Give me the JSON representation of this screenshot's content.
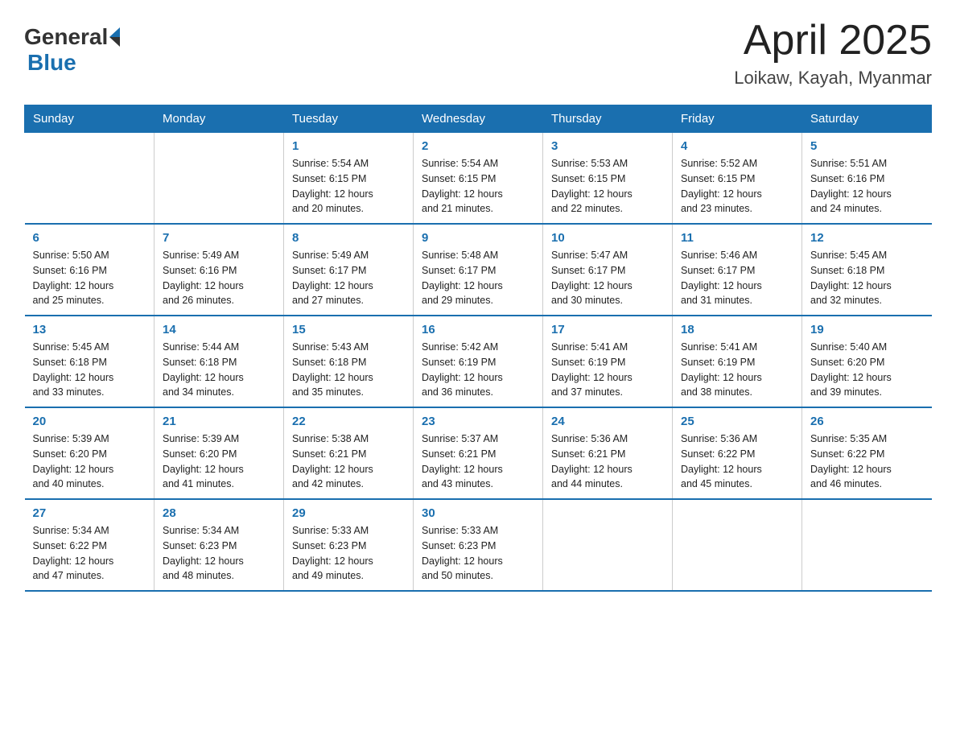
{
  "logo": {
    "general": "General",
    "triangle": "",
    "blue": "Blue"
  },
  "title": "April 2025",
  "subtitle": "Loikaw, Kayah, Myanmar",
  "days_of_week": [
    "Sunday",
    "Monday",
    "Tuesday",
    "Wednesday",
    "Thursday",
    "Friday",
    "Saturday"
  ],
  "weeks": [
    [
      {
        "day": "",
        "info": ""
      },
      {
        "day": "",
        "info": ""
      },
      {
        "day": "1",
        "info": "Sunrise: 5:54 AM\nSunset: 6:15 PM\nDaylight: 12 hours\nand 20 minutes."
      },
      {
        "day": "2",
        "info": "Sunrise: 5:54 AM\nSunset: 6:15 PM\nDaylight: 12 hours\nand 21 minutes."
      },
      {
        "day": "3",
        "info": "Sunrise: 5:53 AM\nSunset: 6:15 PM\nDaylight: 12 hours\nand 22 minutes."
      },
      {
        "day": "4",
        "info": "Sunrise: 5:52 AM\nSunset: 6:15 PM\nDaylight: 12 hours\nand 23 minutes."
      },
      {
        "day": "5",
        "info": "Sunrise: 5:51 AM\nSunset: 6:16 PM\nDaylight: 12 hours\nand 24 minutes."
      }
    ],
    [
      {
        "day": "6",
        "info": "Sunrise: 5:50 AM\nSunset: 6:16 PM\nDaylight: 12 hours\nand 25 minutes."
      },
      {
        "day": "7",
        "info": "Sunrise: 5:49 AM\nSunset: 6:16 PM\nDaylight: 12 hours\nand 26 minutes."
      },
      {
        "day": "8",
        "info": "Sunrise: 5:49 AM\nSunset: 6:17 PM\nDaylight: 12 hours\nand 27 minutes."
      },
      {
        "day": "9",
        "info": "Sunrise: 5:48 AM\nSunset: 6:17 PM\nDaylight: 12 hours\nand 29 minutes."
      },
      {
        "day": "10",
        "info": "Sunrise: 5:47 AM\nSunset: 6:17 PM\nDaylight: 12 hours\nand 30 minutes."
      },
      {
        "day": "11",
        "info": "Sunrise: 5:46 AM\nSunset: 6:17 PM\nDaylight: 12 hours\nand 31 minutes."
      },
      {
        "day": "12",
        "info": "Sunrise: 5:45 AM\nSunset: 6:18 PM\nDaylight: 12 hours\nand 32 minutes."
      }
    ],
    [
      {
        "day": "13",
        "info": "Sunrise: 5:45 AM\nSunset: 6:18 PM\nDaylight: 12 hours\nand 33 minutes."
      },
      {
        "day": "14",
        "info": "Sunrise: 5:44 AM\nSunset: 6:18 PM\nDaylight: 12 hours\nand 34 minutes."
      },
      {
        "day": "15",
        "info": "Sunrise: 5:43 AM\nSunset: 6:18 PM\nDaylight: 12 hours\nand 35 minutes."
      },
      {
        "day": "16",
        "info": "Sunrise: 5:42 AM\nSunset: 6:19 PM\nDaylight: 12 hours\nand 36 minutes."
      },
      {
        "day": "17",
        "info": "Sunrise: 5:41 AM\nSunset: 6:19 PM\nDaylight: 12 hours\nand 37 minutes."
      },
      {
        "day": "18",
        "info": "Sunrise: 5:41 AM\nSunset: 6:19 PM\nDaylight: 12 hours\nand 38 minutes."
      },
      {
        "day": "19",
        "info": "Sunrise: 5:40 AM\nSunset: 6:20 PM\nDaylight: 12 hours\nand 39 minutes."
      }
    ],
    [
      {
        "day": "20",
        "info": "Sunrise: 5:39 AM\nSunset: 6:20 PM\nDaylight: 12 hours\nand 40 minutes."
      },
      {
        "day": "21",
        "info": "Sunrise: 5:39 AM\nSunset: 6:20 PM\nDaylight: 12 hours\nand 41 minutes."
      },
      {
        "day": "22",
        "info": "Sunrise: 5:38 AM\nSunset: 6:21 PM\nDaylight: 12 hours\nand 42 minutes."
      },
      {
        "day": "23",
        "info": "Sunrise: 5:37 AM\nSunset: 6:21 PM\nDaylight: 12 hours\nand 43 minutes."
      },
      {
        "day": "24",
        "info": "Sunrise: 5:36 AM\nSunset: 6:21 PM\nDaylight: 12 hours\nand 44 minutes."
      },
      {
        "day": "25",
        "info": "Sunrise: 5:36 AM\nSunset: 6:22 PM\nDaylight: 12 hours\nand 45 minutes."
      },
      {
        "day": "26",
        "info": "Sunrise: 5:35 AM\nSunset: 6:22 PM\nDaylight: 12 hours\nand 46 minutes."
      }
    ],
    [
      {
        "day": "27",
        "info": "Sunrise: 5:34 AM\nSunset: 6:22 PM\nDaylight: 12 hours\nand 47 minutes."
      },
      {
        "day": "28",
        "info": "Sunrise: 5:34 AM\nSunset: 6:23 PM\nDaylight: 12 hours\nand 48 minutes."
      },
      {
        "day": "29",
        "info": "Sunrise: 5:33 AM\nSunset: 6:23 PM\nDaylight: 12 hours\nand 49 minutes."
      },
      {
        "day": "30",
        "info": "Sunrise: 5:33 AM\nSunset: 6:23 PM\nDaylight: 12 hours\nand 50 minutes."
      },
      {
        "day": "",
        "info": ""
      },
      {
        "day": "",
        "info": ""
      },
      {
        "day": "",
        "info": ""
      }
    ]
  ]
}
